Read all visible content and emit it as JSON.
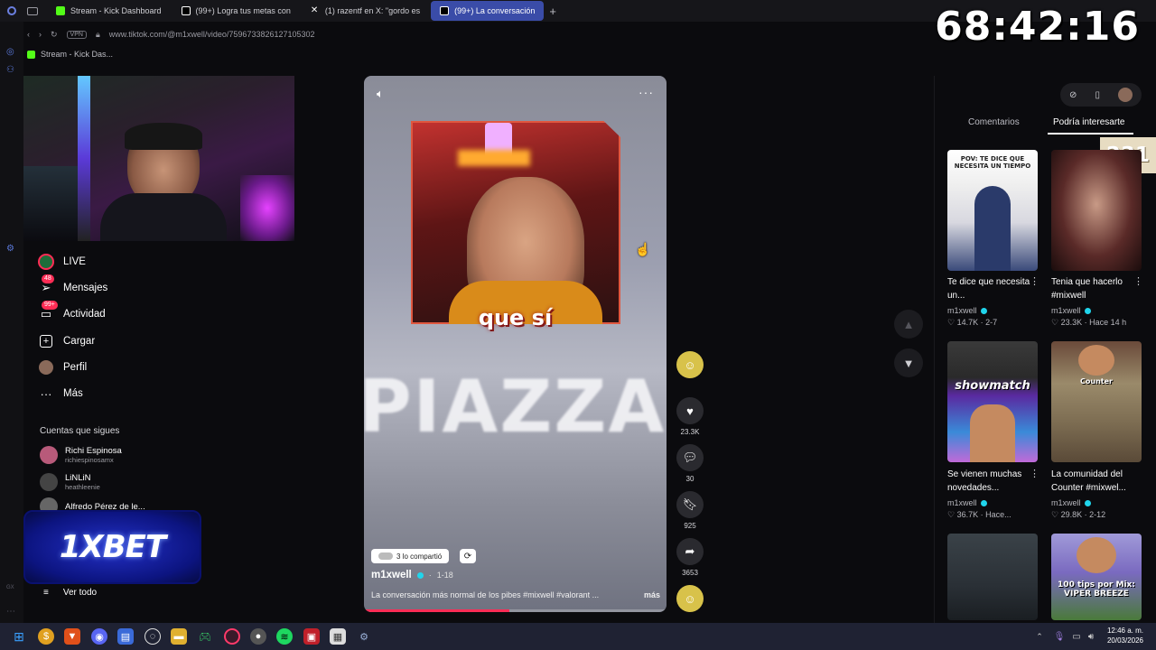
{
  "browser": {
    "tabs": [
      {
        "label": "Stream - Kick Dashboard",
        "active": false,
        "icon": "kick-icon",
        "color": "#53fc18"
      },
      {
        "label": "(99+) Logra tus metas con",
        "active": false,
        "icon": "tiktok-icon",
        "color": "#ffffff"
      },
      {
        "label": "(1) razentf en X: \"gordo es",
        "active": false,
        "icon": "x-icon",
        "color": "#ffffff"
      },
      {
        "label": "(99+) La conversación",
        "active": true,
        "icon": "tiktok-icon",
        "color": "#ffffff"
      }
    ],
    "new_tab": "+",
    "vpn_label": "VPN",
    "url": "www.tiktok.com/@m1xwell/video/7596733826127105302",
    "bookmarks": [
      {
        "label": "Stream - Kick Das...",
        "icon": "kick-icon"
      }
    ]
  },
  "timer": "68:42:16",
  "sidebar": {
    "nav": [
      {
        "label": "LIVE",
        "icon": "live-icon",
        "badge": ""
      },
      {
        "label": "Mensajes",
        "icon": "send-icon",
        "badge": "48"
      },
      {
        "label": "Actividad",
        "icon": "inbox-icon",
        "badge": "99+"
      },
      {
        "label": "Cargar",
        "icon": "upload-icon",
        "badge": ""
      },
      {
        "label": "Perfil",
        "icon": "avatar-icon",
        "badge": ""
      },
      {
        "label": "Más",
        "icon": "more-icon",
        "badge": ""
      }
    ],
    "following_title": "Cuentas que sigues",
    "following": [
      {
        "name": "Richi Espinosa",
        "handle": "richiespinosamx"
      },
      {
        "name": "LiNLiN",
        "handle": "heathleenie"
      },
      {
        "name": "Alfredo Pérez de le...",
        "handle": ""
      }
    ],
    "ad_text": "1XBET",
    "see_all": "Ver todo"
  },
  "video": {
    "caption_word": "que sí",
    "big_word": "PIAZZA",
    "repost_text": "3 lo compartió",
    "author": "m1xwell",
    "date": "1-18",
    "description": "La conversación más normal de los pibes #mixwell #valorant ...",
    "more_label": "más",
    "progress": 0.48
  },
  "actions": {
    "likes": "23.3K",
    "comments": "30",
    "saves": "925",
    "shares": "3653"
  },
  "right_panel": {
    "tabs": [
      "Comentarios",
      "Podría interesarte"
    ],
    "active_tab": 1,
    "overlay_count": "231",
    "cards": [
      {
        "thumb_text": "POV: TE DICE QUE NECESITA UN TIEMPO",
        "title": "Te dice que necesita un...",
        "user": "m1xwell",
        "likes": "14.7K",
        "time": "2-7"
      },
      {
        "thumb_text": "",
        "title": "Tenia que hacerlo #mixwell",
        "user": "m1xwell",
        "likes": "23.3K",
        "time": "Hace 14 h"
      },
      {
        "thumb_text": "showmatch",
        "title": "Se vienen muchas novedades...",
        "user": "m1xwell",
        "likes": "36.7K",
        "time": "Hace..."
      },
      {
        "thumb_text": "Counter",
        "title": "La comunidad del Counter #mixwel...",
        "user": "m1xwell",
        "likes": "29.8K",
        "time": "2-12"
      },
      {
        "thumb_text": "",
        "title": "",
        "user": "",
        "likes": "",
        "time": ""
      },
      {
        "thumb_text": "100 tips por Mix: VIPER BREEZE",
        "title": "",
        "user": "",
        "likes": "",
        "time": ""
      }
    ]
  },
  "taskbar": {
    "time": "12:46 a. m.",
    "date": "20/03/2026"
  },
  "colors": {
    "tiktok_red": "#fe2c55",
    "verified": "#20d5ec",
    "active_tab": "#3a4ca8"
  }
}
